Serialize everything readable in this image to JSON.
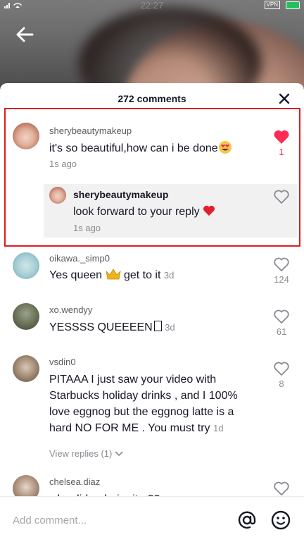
{
  "status_bar": {
    "time": "22:27",
    "vpn": "VPN"
  },
  "sheet": {
    "title": "272 comments"
  },
  "comments": [
    {
      "username": "sherybeautymakeup",
      "text": "it's so beautiful,how can i be done",
      "time": "1s ago",
      "likes": "1",
      "liked": true
    },
    {
      "username": "sherybeautymakeup",
      "text": "look forward to your reply",
      "time": "1s ago",
      "likes": ""
    },
    {
      "username": "oikawa._simp0",
      "text": "Yes queen",
      "text_after": "get to it",
      "time": "3d",
      "likes": "124"
    },
    {
      "username": "xo.wendyy",
      "text": "YESSSS QUEEEEN",
      "time": "3d",
      "likes": "61"
    },
    {
      "username": "vsdin0",
      "text_lines": [
        "PITAAA I just saw your video with",
        "Starbucks holiday drinks , and I 100%",
        "love eggnog but the eggnog latte is a",
        "hard NO FOR ME . You must try"
      ],
      "time": "1d",
      "likes": "8",
      "view_replies": "View replies (1)"
    },
    {
      "username": "chelsea.diaz",
      "text": "who did ur hair nite ??",
      "likes": ""
    }
  ],
  "input": {
    "placeholder": "Add comment..."
  },
  "icons": [
    "back-arrow-icon",
    "close-icon",
    "heart-icon",
    "at-icon",
    "emoji-icon",
    "chevron-down-icon",
    "wifi-icon",
    "signal-icon",
    "battery-icon"
  ],
  "colors": {
    "accent": "#fe2c55",
    "highlight_border": "#e11b1b",
    "reply_bg": "#f1f1f2"
  }
}
